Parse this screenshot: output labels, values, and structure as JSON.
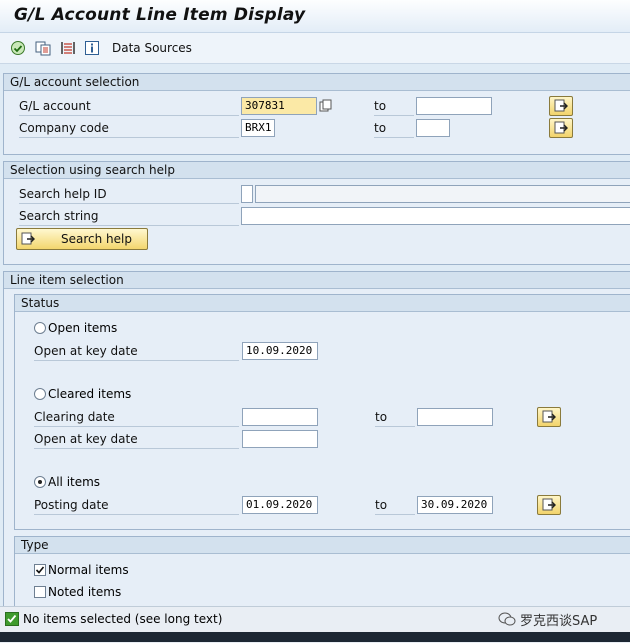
{
  "title": "G/L Account Line Item Display",
  "toolbar": {
    "data_sources": "Data Sources"
  },
  "gl_selection": {
    "header": "G/L account selection",
    "gl_account_label": "G/L account",
    "gl_account_value": "307831",
    "company_code_label": "Company code",
    "company_code_value": "BRX1",
    "to": "to"
  },
  "search_help": {
    "header": "Selection using search help",
    "id_label": "Search help ID",
    "string_label": "Search string",
    "button": "Search help"
  },
  "line_item": {
    "header": "Line item selection",
    "status_header": "Status",
    "open_items": "Open items",
    "open_key_date_label": "Open at key date",
    "open_key_date_value": "10.09.2020",
    "cleared_items": "Cleared items",
    "clearing_date_label": "Clearing date",
    "cleared_key_date_label": "Open at key date",
    "all_items": "All items",
    "posting_date_label": "Posting date",
    "posting_from": "01.09.2020",
    "posting_to": "30.09.2020",
    "to": "to",
    "selected_status": "all_items",
    "type_header": "Type",
    "normal_items": "Normal items",
    "normal_checked": true,
    "noted_items": "Noted items",
    "noted_checked": false
  },
  "status_bar": {
    "message": "No items selected (see long text)"
  },
  "watermark": "罗克西谈SAP",
  "colors": {
    "required_field": "#fbe9a6",
    "button": "#f3d66e",
    "background": "#dfebf5"
  }
}
